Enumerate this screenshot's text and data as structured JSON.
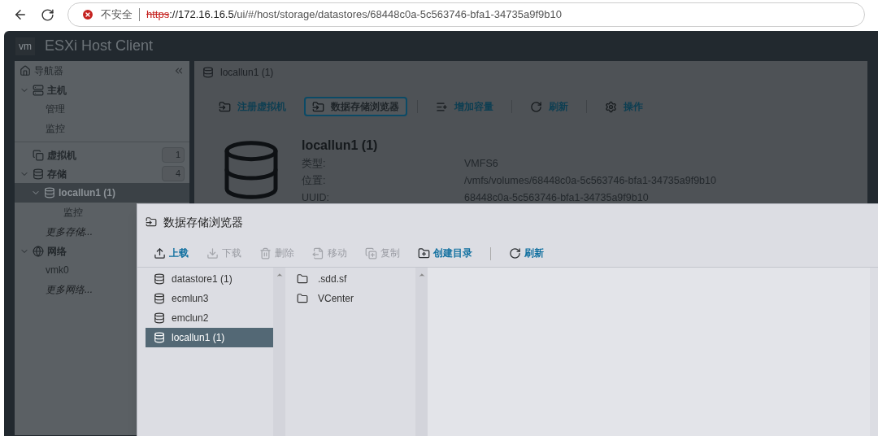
{
  "browser": {
    "security": "不安全",
    "url_scheme": "https",
    "url_host": "://172.16.16.5",
    "url_path": "/ui/#/host/storage/datastores/68448c0a-5c563746-bfa1-34735a9f9b10"
  },
  "app": {
    "logo": "vm",
    "title": "ESXi Host Client"
  },
  "navigator": {
    "title": "导航器",
    "items": [
      {
        "kind": "host",
        "label": "主机",
        "expanded": true,
        "children": [
          {
            "label": "管理",
            "selected": false,
            "italic": false
          },
          {
            "label": "监控",
            "selected": false,
            "italic": false
          }
        ]
      },
      {
        "kind": "vm",
        "label": "虚拟机",
        "count": "1"
      },
      {
        "kind": "storage",
        "label": "存储",
        "count": "4",
        "expanded": true,
        "children": [
          {
            "label": "locallun1 (1)",
            "selected": true,
            "expanded": true,
            "italic": false,
            "children": [
              {
                "label": "监控",
                "selected": false,
                "italic": false
              }
            ]
          },
          {
            "label": "更多存储...",
            "selected": false,
            "italic": true
          }
        ]
      },
      {
        "kind": "network",
        "label": "网络",
        "expanded": true,
        "children": [
          {
            "label": "vmk0",
            "selected": false,
            "italic": false
          },
          {
            "label": "更多网络...",
            "selected": false,
            "italic": true
          }
        ]
      }
    ]
  },
  "main": {
    "header": "locallun1 (1)",
    "toolbar": [
      {
        "kind": "register",
        "label": "注册虚拟机",
        "selected": false
      },
      {
        "kind": "browser",
        "label": "数据存储浏览器",
        "selected": true
      },
      {
        "kind": "capacity",
        "label": "增加容量",
        "selected": false
      },
      {
        "kind": "refresh",
        "label": "刷新",
        "selected": false
      },
      {
        "kind": "actions",
        "label": "操作",
        "selected": false
      }
    ],
    "details": {
      "name": "locallun1 (1)",
      "rows": [
        {
          "label": "类型:",
          "value": "VMFS6"
        },
        {
          "label": "位置:",
          "value": "/vmfs/volumes/68448c0a-5c563746-bfa1-34735a9f9b10"
        },
        {
          "label": "UUID:",
          "value": "68448c0a-5c563746-bfa1-34735a9f9b10"
        }
      ]
    }
  },
  "dialog": {
    "title": "数据存储浏览器",
    "toolbar": [
      {
        "kind": "upload",
        "label": "上载",
        "disabled": false
      },
      {
        "kind": "download",
        "label": "下载",
        "disabled": true
      },
      {
        "kind": "delete",
        "label": "删除",
        "disabled": true
      },
      {
        "kind": "move",
        "label": "移动",
        "disabled": true
      },
      {
        "kind": "copy",
        "label": "复制",
        "disabled": true
      },
      {
        "kind": "mkdir",
        "label": "创建目录",
        "disabled": false
      },
      {
        "kind": "refresh",
        "label": "刷新",
        "disabled": false
      }
    ],
    "datastores": [
      {
        "label": "datastore1 (1)",
        "selected": false
      },
      {
        "label": "ecmlun3",
        "selected": false
      },
      {
        "label": "emclun2",
        "selected": false
      },
      {
        "label": "locallun1 (1)",
        "selected": true
      }
    ],
    "folders": [
      {
        "label": ".sdd.sf",
        "selected": false
      },
      {
        "label": "VCenter",
        "selected": false
      }
    ]
  }
}
